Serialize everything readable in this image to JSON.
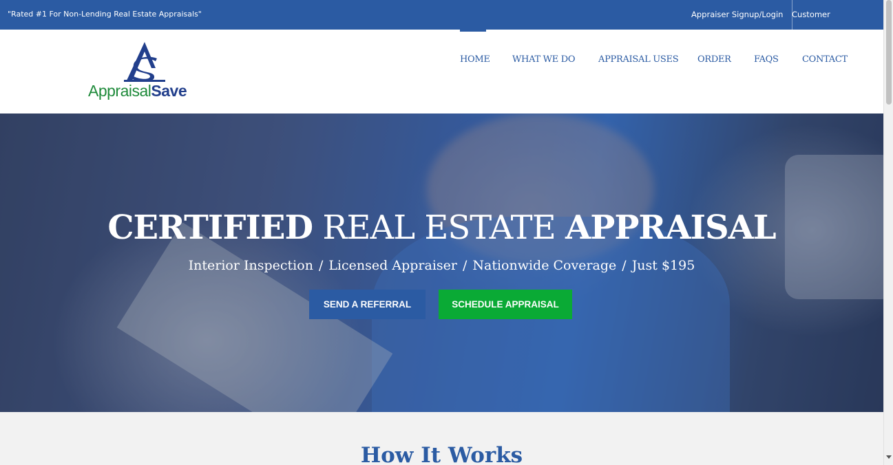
{
  "topbar": {
    "tagline": "\"Rated #1 For Non-Lending Real Estate Appraisals\"",
    "appraiser_link": "Appraiser Signup/Login",
    "customer_link": "Customer Signup/Login"
  },
  "logo": {
    "word1": "Appraisal",
    "word2": "Save",
    "icon": "appraisalsave-as-logo-icon"
  },
  "nav": {
    "items": [
      "HOME",
      "WHAT WE DO",
      "APPRAISAL USES",
      "ORDER",
      "FAQS",
      "CONTACT"
    ],
    "active": "HOME"
  },
  "hero": {
    "title_bold1": "CERTIFIED",
    "title_light": "REAL ESTATE",
    "title_bold2": "APPRAISAL",
    "sub": [
      "Interior Inspection",
      "Licensed Appraiser",
      "Nationwide Coverage",
      "Just $195"
    ],
    "separator": "/",
    "btn_referral": "SEND A REFERRAL",
    "btn_schedule": "SCHEDULE APPRAISAL"
  },
  "section": {
    "title": "How It Works"
  },
  "colors": {
    "brand_blue": "#2b5ba3",
    "cta_green": "#0aaa35",
    "logo_green": "#1e8a3a",
    "logo_navy": "#223f8c"
  }
}
